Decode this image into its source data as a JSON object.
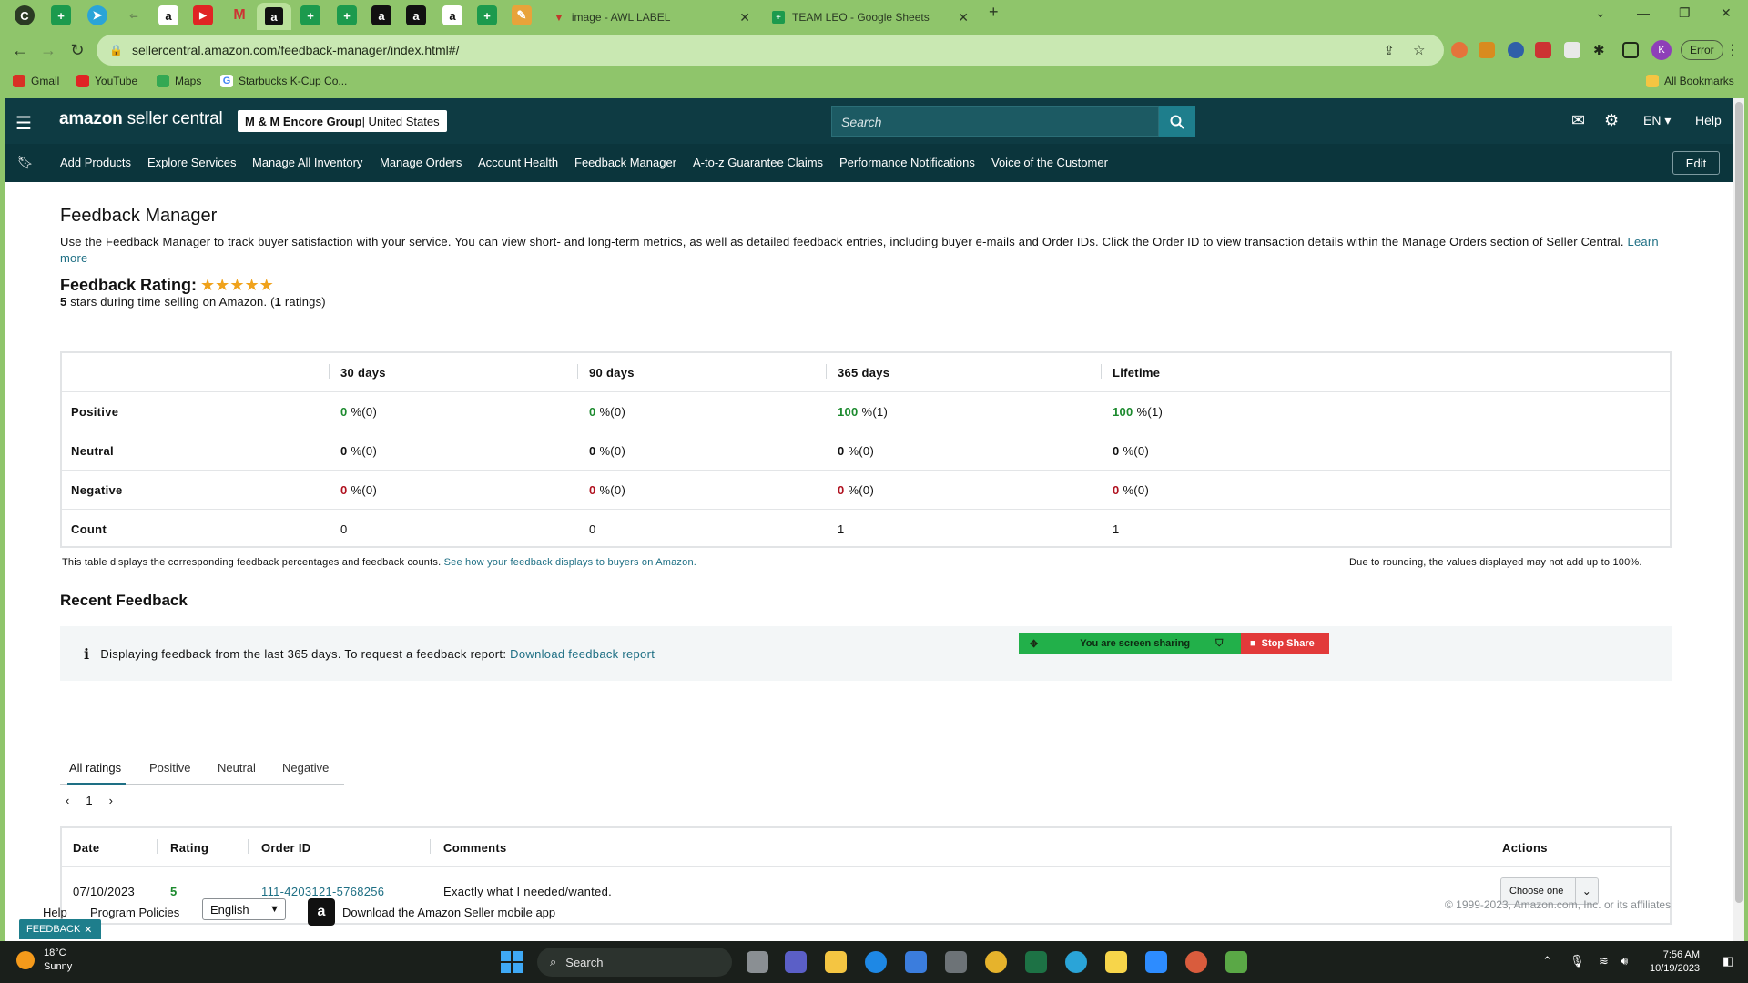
{
  "browser": {
    "tabs": [
      {
        "label": "image - AWL LABEL"
      },
      {
        "label": "TEAM LEO - Google Sheets"
      }
    ],
    "url": "sellercentral.amazon.com/feedback-manager/index.html#/",
    "error_label": "Error",
    "profile_initial": "K",
    "bookmarks": [
      "Gmail",
      "YouTube",
      "Maps",
      "Starbucks K-Cup Co...",
      "All Bookmarks"
    ]
  },
  "header": {
    "logo_bold": "amazon",
    "logo_light": " seller central",
    "account_name": "M & M Encore Group",
    "account_region": " | United States",
    "search_placeholder": "Search",
    "language": "EN",
    "help": "Help"
  },
  "nav": {
    "items": [
      "Add Products",
      "Explore Services",
      "Manage All Inventory",
      "Manage Orders",
      "Account Health",
      "Feedback Manager",
      "A-to-z Guarantee Claims",
      "Performance Notifications",
      "Voice of the Customer"
    ],
    "edit": "Edit"
  },
  "feedback": {
    "title": "Feedback Manager",
    "intro": "Use the Feedback Manager to track buyer satisfaction with your service. You can view short- and long-term metrics, as well as detailed feedback entries, including buyer e-mails and Order IDs. Click the Order ID to view transaction details within the Manage Orders section of Seller Central.",
    "learn_more": "Learn more",
    "rating_label": "Feedback Rating:",
    "stars": 5,
    "rating_stars_value": "5",
    "rating_mid": " stars during time selling on Amazon. (",
    "rating_count": "1",
    "rating_end": " ratings)",
    "columns": [
      "30 days",
      "90 days",
      "365 days",
      "Lifetime"
    ],
    "rows": [
      {
        "label": "Positive",
        "values": [
          {
            "num": "0",
            "rest": " %(0)"
          },
          {
            "num": "0",
            "rest": " %(0)"
          },
          {
            "num": "100",
            "rest": " %(1)"
          },
          {
            "num": "100",
            "rest": " %(1)"
          }
        ]
      },
      {
        "label": "Neutral",
        "values": [
          {
            "num": "0",
            "rest": " %(0)"
          },
          {
            "num": "0",
            "rest": " %(0)"
          },
          {
            "num": "0",
            "rest": " %(0)"
          },
          {
            "num": "0",
            "rest": " %(0)"
          }
        ]
      },
      {
        "label": "Negative",
        "values": [
          {
            "num": "0",
            "rest": " %(0)"
          },
          {
            "num": "0",
            "rest": " %(0)"
          },
          {
            "num": "0",
            "rest": " %(0)"
          },
          {
            "num": "0",
            "rest": " %(0)"
          }
        ]
      },
      {
        "label": "Count",
        "values": [
          {
            "num": "0",
            "rest": ""
          },
          {
            "num": "0",
            "rest": ""
          },
          {
            "num": "1",
            "rest": ""
          },
          {
            "num": "1",
            "rest": ""
          }
        ]
      }
    ],
    "table_note": "This table displays the corresponding feedback percentages and feedback counts.",
    "table_note_link": "See how your feedback displays to buyers on Amazon.",
    "rounding_note": "Due to rounding, the values displayed may not add up to 100%."
  },
  "recent": {
    "title": "Recent Feedback",
    "info_text": "Displaying feedback from the last 365 days. To request a feedback report:",
    "info_link": "Download feedback report",
    "tabs": [
      "All ratings",
      "Positive",
      "Neutral",
      "Negative"
    ],
    "page": "1",
    "headers": [
      "Date",
      "Rating",
      "Order ID",
      "Comments",
      "Actions"
    ],
    "row": {
      "date": "07/10/2023",
      "rating": "5",
      "order_id": "111-4203121-5768256",
      "comment": "Exactly what I needed/wanted.",
      "action": "Choose one"
    }
  },
  "screen_share": {
    "status": "You are screen sharing",
    "stop": "Stop Share"
  },
  "footer": {
    "help": "Help",
    "policies": "Program Policies",
    "language": "English",
    "app_text": "Download the Amazon Seller mobile app",
    "copyright": "© 1999-2023, Amazon.com, Inc. or its affiliates",
    "feedback_tab": "FEEDBACK"
  },
  "taskbar": {
    "temp": "18°C",
    "weather": "Sunny",
    "search": "Search",
    "time": "7:56 AM",
    "date": "10/19/2023"
  },
  "colors": {
    "header_bg": "#0e3b43",
    "nav_bg": "#0b353c",
    "link": "#1e6f84",
    "positive": "#1c8a2e",
    "negative": "#b0111f",
    "star": "#f0a21b",
    "chrome": "#8fc56b"
  }
}
